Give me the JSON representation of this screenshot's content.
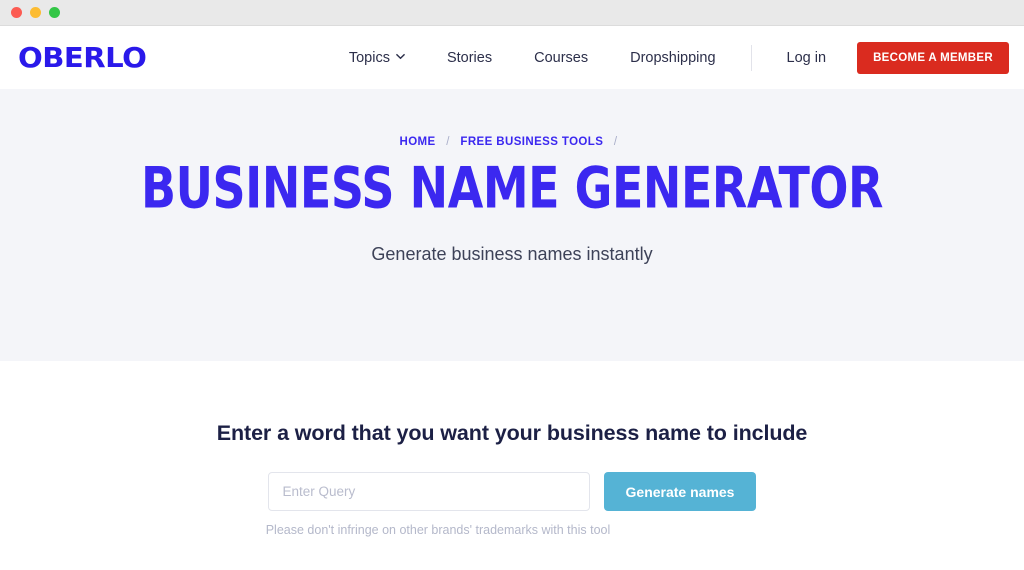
{
  "window": {
    "traffic_lights": [
      {
        "name": "close",
        "color": "#fc5b52"
      },
      {
        "name": "minimize",
        "color": "#fcbc32"
      },
      {
        "name": "zoom",
        "color": "#33c646"
      }
    ]
  },
  "header": {
    "logo": "OBERLO",
    "nav": [
      {
        "label": "Topics",
        "icon": "chevron-down-icon",
        "has_dropdown": true
      },
      {
        "label": "Stories",
        "has_dropdown": false
      },
      {
        "label": "Courses",
        "has_dropdown": false
      },
      {
        "label": "Dropshipping",
        "has_dropdown": false
      }
    ],
    "login_label": "Log in",
    "member_button_label": "BECOME A MEMBER",
    "member_button_color": "#da2b1f"
  },
  "hero": {
    "background_color": "#f4f5f9",
    "breadcrumb": {
      "items": [
        {
          "label": "HOME"
        },
        {
          "label": "FREE BUSINESS TOOLS"
        }
      ],
      "separator": "/",
      "trailing_separator": "/",
      "link_color": "#3b28f0"
    },
    "title": "BUSINESS NAME GENERATOR",
    "title_color": "#3b28f0",
    "subtitle": "Generate business names instantly"
  },
  "tool": {
    "heading": "Enter a word that you want your business name to include",
    "input": {
      "value": "",
      "placeholder": "Enter Query"
    },
    "generate_button_label": "Generate names",
    "generate_button_color": "#55b3d5",
    "helper_text": "Please don't infringe on other brands' trademarks with this tool"
  }
}
